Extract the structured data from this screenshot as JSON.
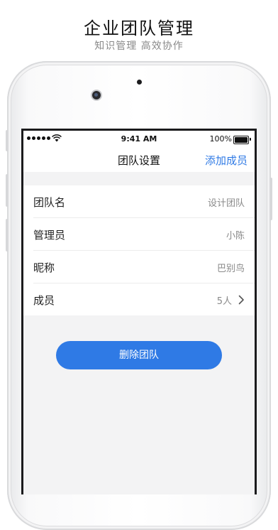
{
  "promo": {
    "title": "企业团队管理",
    "subtitle": "知识管理 高效协作"
  },
  "status_bar": {
    "time": "9:41 AM",
    "battery": "100%"
  },
  "nav": {
    "title": "团队设置",
    "action": "添加成员"
  },
  "rows": [
    {
      "label": "团队名",
      "value": "设计团队"
    },
    {
      "label": "管理员",
      "value": "小陈"
    },
    {
      "label": "昵称",
      "value": "巴别鸟"
    },
    {
      "label": "成员",
      "value": "5人"
    }
  ],
  "delete_button": "删除团队",
  "colors": {
    "accent": "#2f7ae5",
    "background": "#f3f3f4"
  }
}
